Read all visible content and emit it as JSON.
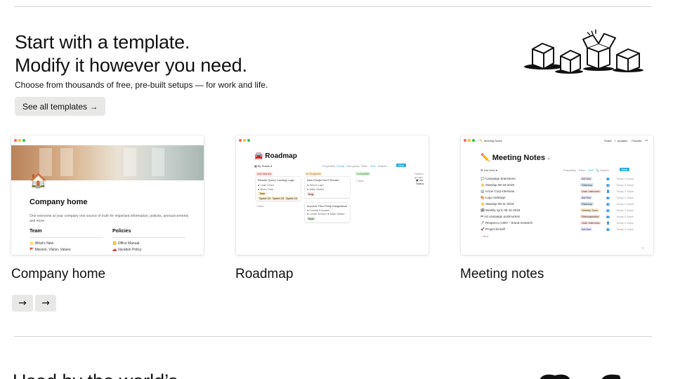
{
  "hero": {
    "title_line1": "Start with a template.",
    "title_line2": "Modify it however you need.",
    "subtitle": "Choose from thousands of free, pre-built setups — for work and life.",
    "cta_label": "See all templates →"
  },
  "cards": [
    {
      "label": "Company home",
      "preview": {
        "title": "Company home",
        "description": "One everyone at your company one source of truth for important information, policies, announcements and more.",
        "col_a": "Team",
        "col_b": "Policies",
        "col_a_items": [
          "What's New",
          "Mission, Vision, Values"
        ],
        "col_b_items": [
          "Office Manual",
          "Vacation Policy"
        ]
      }
    },
    {
      "label": "Roadmap",
      "preview": {
        "title": "Roadmap",
        "view": "By Status",
        "toolbar": [
          "Properties",
          "Group",
          "Sort group",
          "Filter",
          "Sort",
          "Search"
        ],
        "new_label": "New",
        "columns": [
          "Not Started",
          "In Progress",
          "Complete"
        ],
        "cards": {
          "not_started": {
            "title": "Rewrite Query Caching Logic",
            "people": [
              "Leah Chen",
              "Brian Park"
            ],
            "tag": "Task",
            "sprints": [
              "Sprint 23",
              "Sprint 23",
              "Sprint 24"
            ]
          },
          "in_progress_1": {
            "title": "New Emojis Don't Render",
            "people": [
              "Simon Lapi",
              "Mike Shake"
            ],
            "tag": "Bug"
          },
          "in_progress_2": {
            "title": "Improve Third Party Integrations",
            "people": [
              "Camila Knowles",
              "Leslie Jensen",
              "Mike Shake"
            ],
            "tag": "Epic"
          }
        },
        "add_new": "+ New",
        "hidden_groups": "Hidden groups",
        "no_status": "No Status"
      }
    },
    {
      "label": "Meeting notes",
      "preview": {
        "breadcrumb": "Meeting Notes",
        "top_actions": [
          "Share",
          "Updates",
          "Favorite"
        ],
        "title": "Meeting Notes",
        "view": "List View",
        "toolbar": [
          "Properties",
          "Filter",
          "Sort",
          "Search"
        ],
        "new_label": "New",
        "rows": [
          {
            "name": "Campaign brainstorm",
            "tag": "Ad Hoc",
            "date": "Today 2:16pm"
          },
          {
            "name": "Standup 06-18-2019",
            "tag": "Standup",
            "date": "Today 2:16pm"
          },
          {
            "name": "Acme Corp interview",
            "tag": "User Interview",
            "date": "Today 2:16pm"
          },
          {
            "name": "Logo redesign",
            "tag": "Ad Hoc",
            "date": "Today 2:16pm"
          },
          {
            "name": "Standup 06-11-2019",
            "tag": "Standup",
            "date": "Today 2:16pm"
          },
          {
            "name": "Weekly sync 06-11-2019",
            "tag": "Weekly Sync",
            "date": "Today 2:16pm"
          },
          {
            "name": "Ad campaign postmortem",
            "tag": "Retrospective",
            "date": "Today 2:16pm"
          },
          {
            "name": "Respecco CMO – brand research",
            "tag": "User Interview",
            "date": "Today 2:16pm"
          },
          {
            "name": "Project kickoff",
            "tag": "Ad Hoc",
            "date": "Today 2:16pm"
          }
        ],
        "add_new": "+ New",
        "help": "?"
      }
    }
  ],
  "carousel": {
    "prev_label": "→",
    "next_label": "→"
  },
  "next_section": {
    "heading": "Used by the world’s"
  },
  "colors": {
    "button_bg": "#e8e8e6",
    "rule": "#d6d6d4",
    "accent_blue": "#2eaadc"
  }
}
